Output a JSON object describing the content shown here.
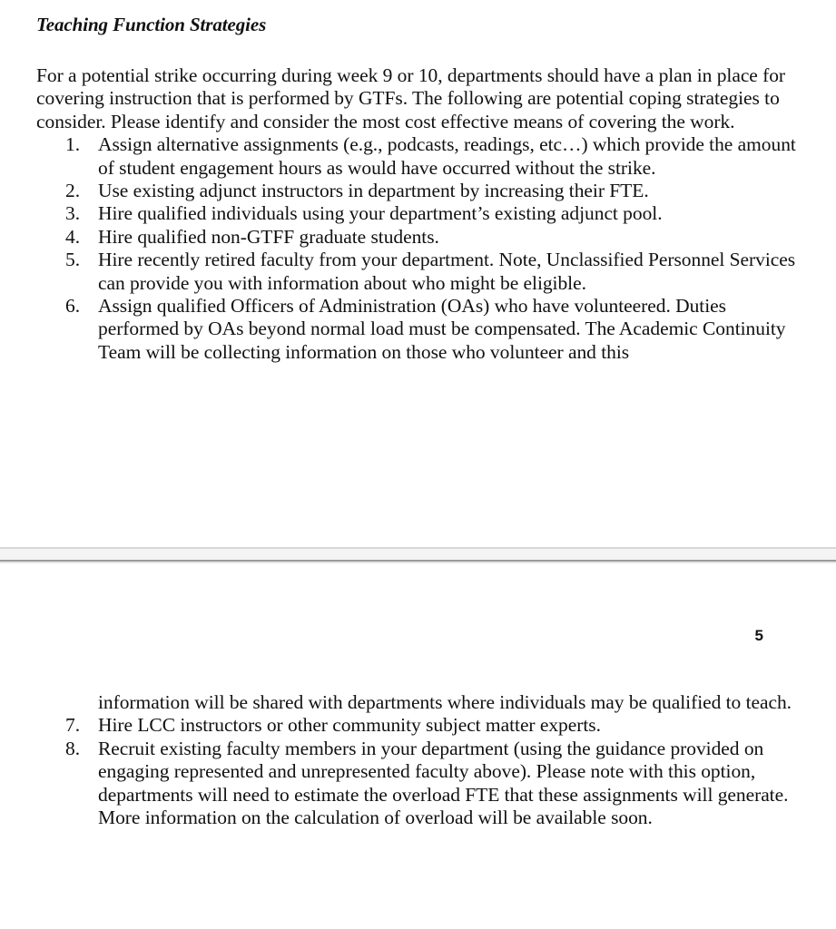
{
  "document": {
    "heading": "Teaching Function Strategies",
    "intro_paragraph": "For a potential strike occurring during week 9 or 10, departments should have a plan in place for covering instruction that is performed by GTFs. The following are potential coping strategies to consider. Please identify and consider the most cost effective means of covering the work."
  },
  "page_one": {
    "list_items": [
      {
        "marker": "1.",
        "text": "Assign alternative assignments (e.g., podcasts, readings, etc…) which provide the amount of student engagement hours as would have occurred without the strike."
      },
      {
        "marker": "2.",
        "text": "Use existing adjunct instructors in department by increasing their FTE."
      },
      {
        "marker": "3.",
        "text": "Hire qualified individuals using your department’s existing adjunct pool."
      },
      {
        "marker": "4.",
        "text": "Hire qualified non-GTFF graduate students."
      },
      {
        "marker": "5.",
        "text": "Hire recently retired faculty from your department. Note, Unclassified Personnel Services can provide you with information about who might be eligible."
      },
      {
        "marker": "6.",
        "text": "Assign qualified Officers of Administration (OAs) who have volunteered. Duties performed by OAs beyond normal load must be compensated.  The Academic Continuity Team will be collecting information on those who volunteer and this"
      }
    ]
  },
  "page_two": {
    "page_number": "5",
    "continuation_paragraph": "information will be shared with departments where individuals may be qualified to teach.",
    "list_items": [
      {
        "marker": "7.",
        "text": "Hire LCC instructors or other community subject matter experts."
      },
      {
        "marker": "8.",
        "text": "Recruit existing faculty members in your department (using the guidance provided on engaging represented and unrepresented faculty above). Please note with this option, departments will need to estimate the overload FTE that these assignments will generate. More information on the calculation of overload will be available soon."
      }
    ]
  }
}
